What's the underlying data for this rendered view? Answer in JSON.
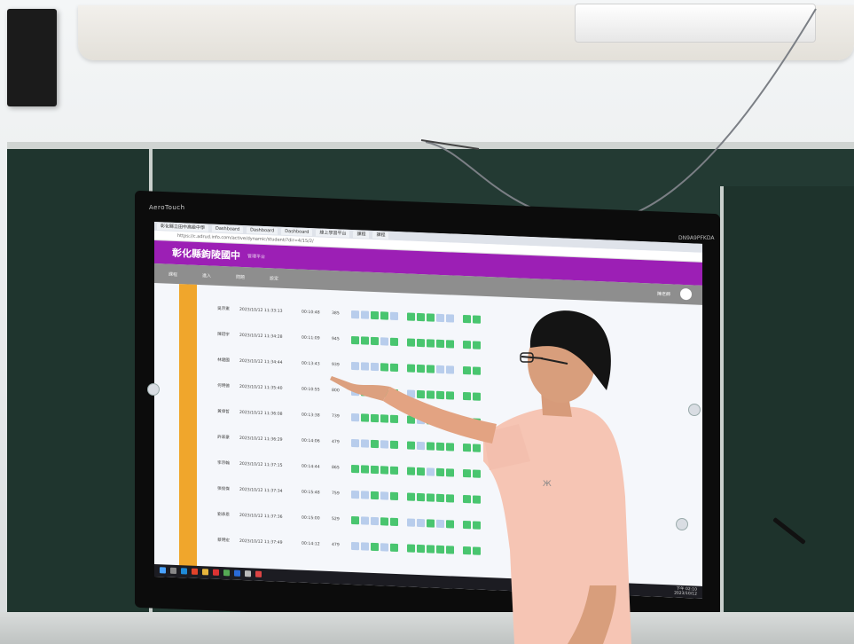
{
  "monitor": {
    "brand": "AeroTouch",
    "model": "DN9A9PFKDA"
  },
  "browser": {
    "tabs": [
      "彰化縣立田中高級中學",
      "Dashboard",
      "Dashboard",
      "Dashboard",
      "線上學習平台",
      "課程",
      "課程"
    ],
    "url": "https://c.adrud.info.com/active/dynamic/student/?dir=4/15/2/"
  },
  "app": {
    "title": "彰化縣鉤陵國中",
    "subtitle": "管理平台",
    "nav": [
      "課程",
      "進入",
      "問題",
      "設定"
    ],
    "user": "陳老師"
  },
  "table": {
    "rows": [
      {
        "name": "吳宗憲",
        "time": "2023/10/12 11:33:13",
        "dur": "00:10:48",
        "score": "385"
      },
      {
        "name": "陳冠宇",
        "time": "2023/10/12 11:34:28",
        "dur": "00:11:09",
        "score": "945"
      },
      {
        "name": "林建國",
        "time": "2023/10/12 11:34:44",
        "dur": "00:13:43",
        "score": "939"
      },
      {
        "name": "何明德",
        "time": "2023/10/12 11:35:40",
        "dur": "00:10:55",
        "score": "800"
      },
      {
        "name": "黃偉哲",
        "time": "2023/10/12 11:36:08",
        "dur": "00:13:38",
        "score": "739"
      },
      {
        "name": "許家豪",
        "time": "2023/10/12 11:36:29",
        "dur": "00:14:06",
        "score": "479"
      },
      {
        "name": "李宗翰",
        "time": "2023/10/12 11:37:15",
        "dur": "00:14:44",
        "score": "865"
      },
      {
        "name": "張俊傑",
        "time": "2023/10/12 11:37:34",
        "dur": "00:15:48",
        "score": "759"
      },
      {
        "name": "劉承恩",
        "time": "2023/10/12 11:37:36",
        "dur": "00:15:00",
        "score": "529"
      },
      {
        "name": "蔡明宏",
        "time": "2023/10/12 11:37:49",
        "dur": "00:14:12",
        "score": "479"
      }
    ]
  },
  "taskbar": {
    "clock_time": "下午 02:10",
    "clock_date": "2023/10/12"
  },
  "colors": {
    "header": "#9c1fb5",
    "correct": "#49c56f",
    "incorrect": "#b8cdec",
    "sidebar": "#f0a62c",
    "board": "#233a33",
    "shirt": "#f6c5b4"
  },
  "icons": [
    "windows-start-icon",
    "search-icon",
    "edge-browser-icon",
    "chrome-icon",
    "folder-icon",
    "avatar-icon"
  ]
}
